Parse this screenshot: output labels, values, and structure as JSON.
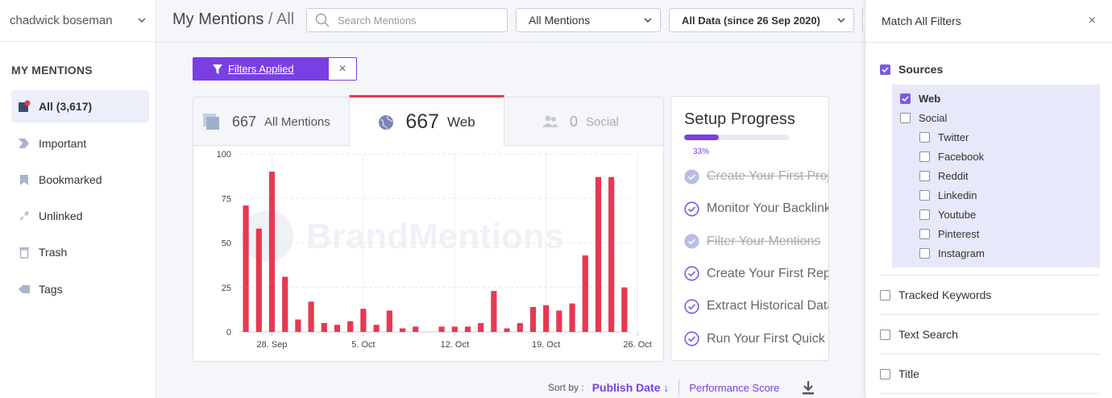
{
  "user": {
    "name": "chadwick boseman"
  },
  "sidebar": {
    "heading": "MY MENTIONS",
    "items": [
      {
        "label": "All (3,617)",
        "icon": "all-mentions-icon",
        "active": true
      },
      {
        "label": "Important",
        "icon": "important-icon"
      },
      {
        "label": "Bookmarked",
        "icon": "bookmark-icon"
      },
      {
        "label": "Unlinked",
        "icon": "unlinked-icon"
      },
      {
        "label": "Trash",
        "icon": "trash-icon"
      },
      {
        "label": "Tags",
        "icon": "tag-icon"
      }
    ]
  },
  "header": {
    "title": "My Mentions",
    "title_sub": " / All",
    "search_placeholder": "Search Mentions",
    "mentions_dropdown": "All Mentions",
    "date_dropdown": "All Data (since 26 Sep 2020)"
  },
  "filters_applied": {
    "label": "Filters Applied",
    "clear": "×"
  },
  "tabs": {
    "all": {
      "count": "667",
      "label": "All Mentions"
    },
    "web": {
      "count": "667",
      "label": "Web"
    },
    "social": {
      "count": "0",
      "label": "Social"
    }
  },
  "chart_data": {
    "type": "bar",
    "title": "",
    "watermark": "BrandMentions",
    "ylim": [
      0,
      100
    ],
    "yticks": [
      0,
      25,
      50,
      75,
      100
    ],
    "xtick_labels": [
      "28. Sep",
      "5. Oct",
      "12. Oct",
      "19. Oct",
      "26. Oct"
    ],
    "xtick_day_index": [
      2,
      9,
      16,
      23,
      30
    ],
    "series": [
      {
        "color": "#e63950",
        "values": [
          71,
          58,
          90,
          31,
          7,
          17,
          5,
          4,
          6,
          13,
          4,
          12,
          2,
          3,
          0,
          3,
          3,
          3,
          5,
          23,
          2,
          5,
          14,
          15,
          12,
          16,
          43,
          87,
          87,
          25
        ]
      }
    ]
  },
  "setup": {
    "title": "Setup Progress",
    "progress": 0.33,
    "progress_label": "33%",
    "steps": [
      {
        "label": "Create Your First Project",
        "done": true
      },
      {
        "label": "Monitor Your Backlinks",
        "done": false
      },
      {
        "label": "Filter Your Mentions",
        "done": true
      },
      {
        "label": "Create Your First Report",
        "done": false
      },
      {
        "label": "Extract Historical Data",
        "done": false
      },
      {
        "label": "Run Your First Quick Search",
        "done": false
      }
    ]
  },
  "sort": {
    "label": "Sort by :",
    "publish_date": "Publish Date ↓",
    "performance": "Performance Score"
  },
  "filter_panel": {
    "title": "Match All Filters",
    "close": "×",
    "sources": {
      "label": "Sources",
      "checked": true
    },
    "web": {
      "label": "Web",
      "checked": true
    },
    "social": {
      "label": "Social",
      "checked": false
    },
    "social_sources": [
      "Twitter",
      "Facebook",
      "Reddit",
      "Linkedin",
      "Youtube",
      "Pinterest",
      "Instagram"
    ],
    "tracked_keywords": "Tracked Keywords",
    "text_search": "Text Search",
    "title_filter": "Title"
  },
  "colors": {
    "accent": "#7a3fe4",
    "bar": "#e63950"
  }
}
